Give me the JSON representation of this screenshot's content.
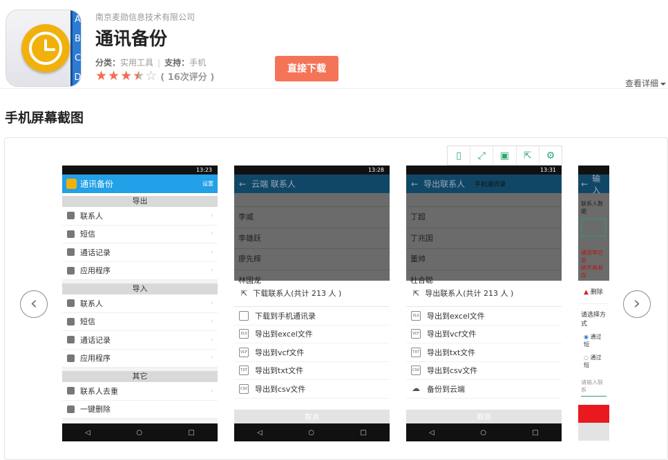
{
  "header": {
    "company": "南京麦勋信息技术有限公司",
    "title": "通讯备份",
    "category_label": "分类：",
    "category_value": "实用工具",
    "support_label": "支持：",
    "support_value": "手机",
    "rating_count": "( 16次评分 )",
    "rating": 3.5,
    "rating_max": 5,
    "download_label": "直接下载",
    "detail_label": "查看详细",
    "icon_tabs": [
      "A",
      "B",
      "C",
      "D"
    ]
  },
  "section_title": "手机屏幕截图",
  "gallery": {
    "toolbar": [
      "phone-frame-icon",
      "fullscreen-icon",
      "save-icon",
      "share-icon",
      "settings-icon"
    ],
    "prev_label": "‹",
    "next_label": "›",
    "shots": [
      {
        "time": "13:23",
        "appbar_title": "通讯备份",
        "appbar_action": "设置",
        "groups": [
          {
            "label": "导出",
            "rows": [
              "联系人",
              "短信",
              "通话记录",
              "应用程序"
            ]
          },
          {
            "label": "导入",
            "rows": [
              "联系人",
              "短信",
              "通话记录",
              "应用程序"
            ]
          },
          {
            "label": "其它",
            "rows": [
              "联系人去重",
              "一键删除"
            ]
          }
        ]
      },
      {
        "time": "13:28",
        "appbar_title": "云端 联系人",
        "list": [
          "",
          "李威",
          "李雄跃",
          "廖先辉",
          "林国龙"
        ],
        "sheet_title": "下载联系人(共计 213 人 )",
        "options": [
          "下载到手机通讯录",
          "导出到excel文件",
          "导出到vcf文件",
          "导出到txt文件",
          "导出到csv文件"
        ],
        "cancel": "取消"
      },
      {
        "time": "13:31",
        "appbar_title": "导出联系人",
        "appbar_sub": "手机通讯录",
        "list": [
          "",
          "丁超",
          "丁兆国",
          "董帅",
          "杜合聪"
        ],
        "sheet_title": "导出联系人(共计 213 人 )",
        "options": [
          "导出到excel文件",
          "导出到vcf文件",
          "导出到txt文件",
          "导出到csv文件",
          "备份到云端"
        ],
        "cancel": "取消"
      },
      {
        "appbar_title": "输入",
        "line1": "联系人数据",
        "warn": "请您牢记妥",
        "warn2": "统不具有存",
        "delete_label": "删除",
        "choose": "请选择方式",
        "radio1": "通过短",
        "radio2": "通过短",
        "input_placeholder": "请输入联系"
      }
    ]
  }
}
